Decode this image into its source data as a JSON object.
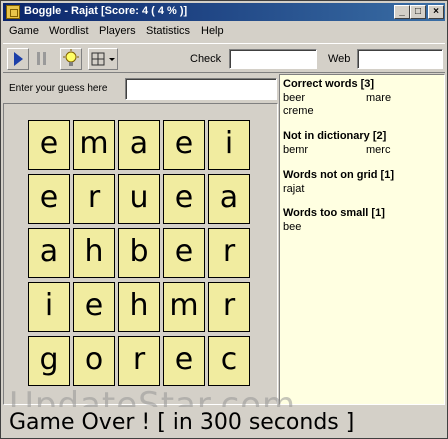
{
  "window": {
    "title": "Boggle - Rajat [Score: 4 ( 4 % )]",
    "controls": [
      "_",
      "□",
      "×"
    ]
  },
  "menu": [
    "Game",
    "Wordlist",
    "Players",
    "Statistics",
    "Help"
  ],
  "toolbar": {
    "icons": [
      "play-icon",
      "pause-icon",
      "hint-bulb-icon",
      "grid-size-icon",
      "dropdown-arrow-icon"
    ],
    "check_label": "Check",
    "check_value": "",
    "web_label": "Web",
    "web_value": ""
  },
  "guess": {
    "label": "Enter your guess here",
    "value": ""
  },
  "grid": [
    [
      "e",
      "m",
      "a",
      "e",
      "i"
    ],
    [
      "e",
      "r",
      "u",
      "e",
      "a"
    ],
    [
      "a",
      "h",
      "b",
      "e",
      "r"
    ],
    [
      "i",
      "e",
      "h",
      "m",
      "r"
    ],
    [
      "g",
      "o",
      "r",
      "e",
      "c"
    ]
  ],
  "results": {
    "correct": {
      "title": "Correct words [3]",
      "words": [
        "beer",
        "mare",
        "creme"
      ]
    },
    "not_in_dictionary": {
      "title": "Not in dictionary [2]",
      "words": [
        "bemr",
        "merc"
      ]
    },
    "not_on_grid": {
      "title": "Words not on grid [1]",
      "words": [
        "rajat"
      ]
    },
    "too_small": {
      "title": "Words too small [1]",
      "words": [
        "bee"
      ]
    }
  },
  "status": {
    "text": "Game Over !    [ in 300 seconds ]"
  },
  "watermark": "UpdateStar.com",
  "colors": {
    "cell_bg": "#f1eca0",
    "results_bg": "#ffffe1",
    "titlebar": "#0a246a"
  }
}
